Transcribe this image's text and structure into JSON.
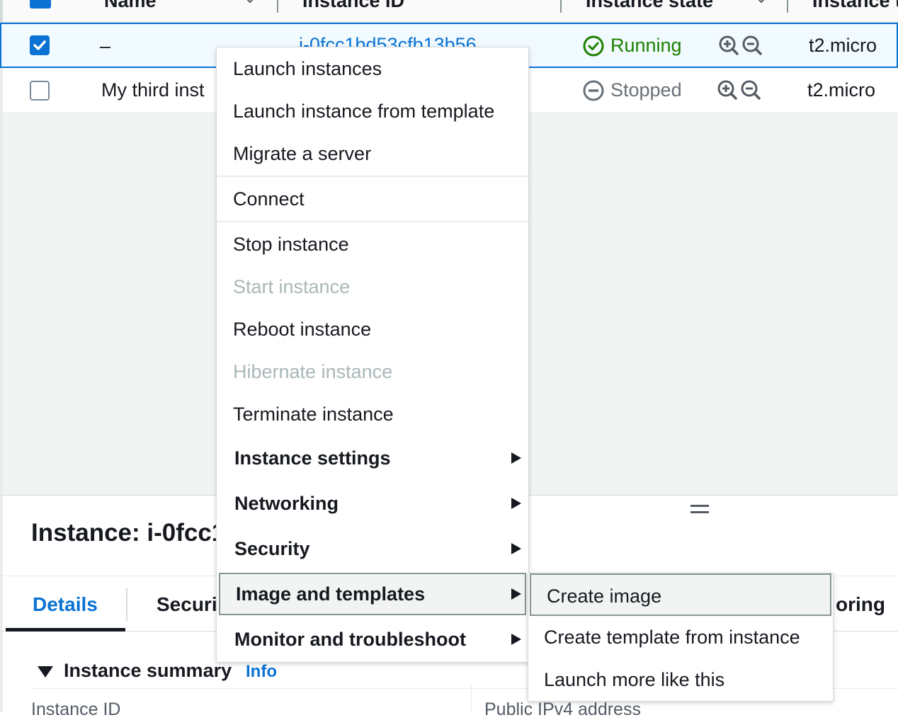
{
  "table": {
    "headers": {
      "name": "Name",
      "instance_id": "Instance ID",
      "instance_state": "Instance state",
      "instance_type": "Instance t"
    },
    "rows": [
      {
        "selected": true,
        "name": "–",
        "instance_id": "i-0fcc1bd53cfb13b56",
        "state": "Running",
        "type": "t2.micro"
      },
      {
        "selected": false,
        "name": "My third inst",
        "instance_id": "",
        "state": "Stopped",
        "type": "t2.micro"
      }
    ]
  },
  "context_menu": {
    "items": [
      {
        "label": "Launch instances",
        "disabled": false
      },
      {
        "label": "Launch instance from template",
        "disabled": false
      },
      {
        "label": "Migrate a server",
        "disabled": false
      },
      {
        "label": "Connect",
        "disabled": false
      },
      {
        "label": "Stop instance",
        "disabled": false
      },
      {
        "label": "Start instance",
        "disabled": true
      },
      {
        "label": "Reboot instance",
        "disabled": false
      },
      {
        "label": "Hibernate instance",
        "disabled": true
      },
      {
        "label": "Terminate instance",
        "disabled": false
      }
    ],
    "submenus": [
      {
        "label": "Instance settings"
      },
      {
        "label": "Networking"
      },
      {
        "label": "Security"
      },
      {
        "label": "Image and templates",
        "highlighted": true
      },
      {
        "label": "Monitor and troubleshoot"
      }
    ]
  },
  "image_templates_submenu": {
    "items": [
      {
        "label": "Create image",
        "highlighted": true
      },
      {
        "label": "Create template from instance"
      },
      {
        "label": "Launch more like this"
      }
    ]
  },
  "details": {
    "title": "Instance: i-0fcc1",
    "tabs": {
      "details": "Details",
      "security": "Securi",
      "monitoring": "oring"
    },
    "summary": {
      "title": "Instance summary",
      "info": "Info",
      "instance_id_label": "Instance ID",
      "public_ip_label": "Public IPv4 address"
    }
  },
  "colors": {
    "accent": "#0972d3",
    "running": "#1d8102",
    "stopped": "#687078",
    "disabled": "#aab7b8"
  }
}
